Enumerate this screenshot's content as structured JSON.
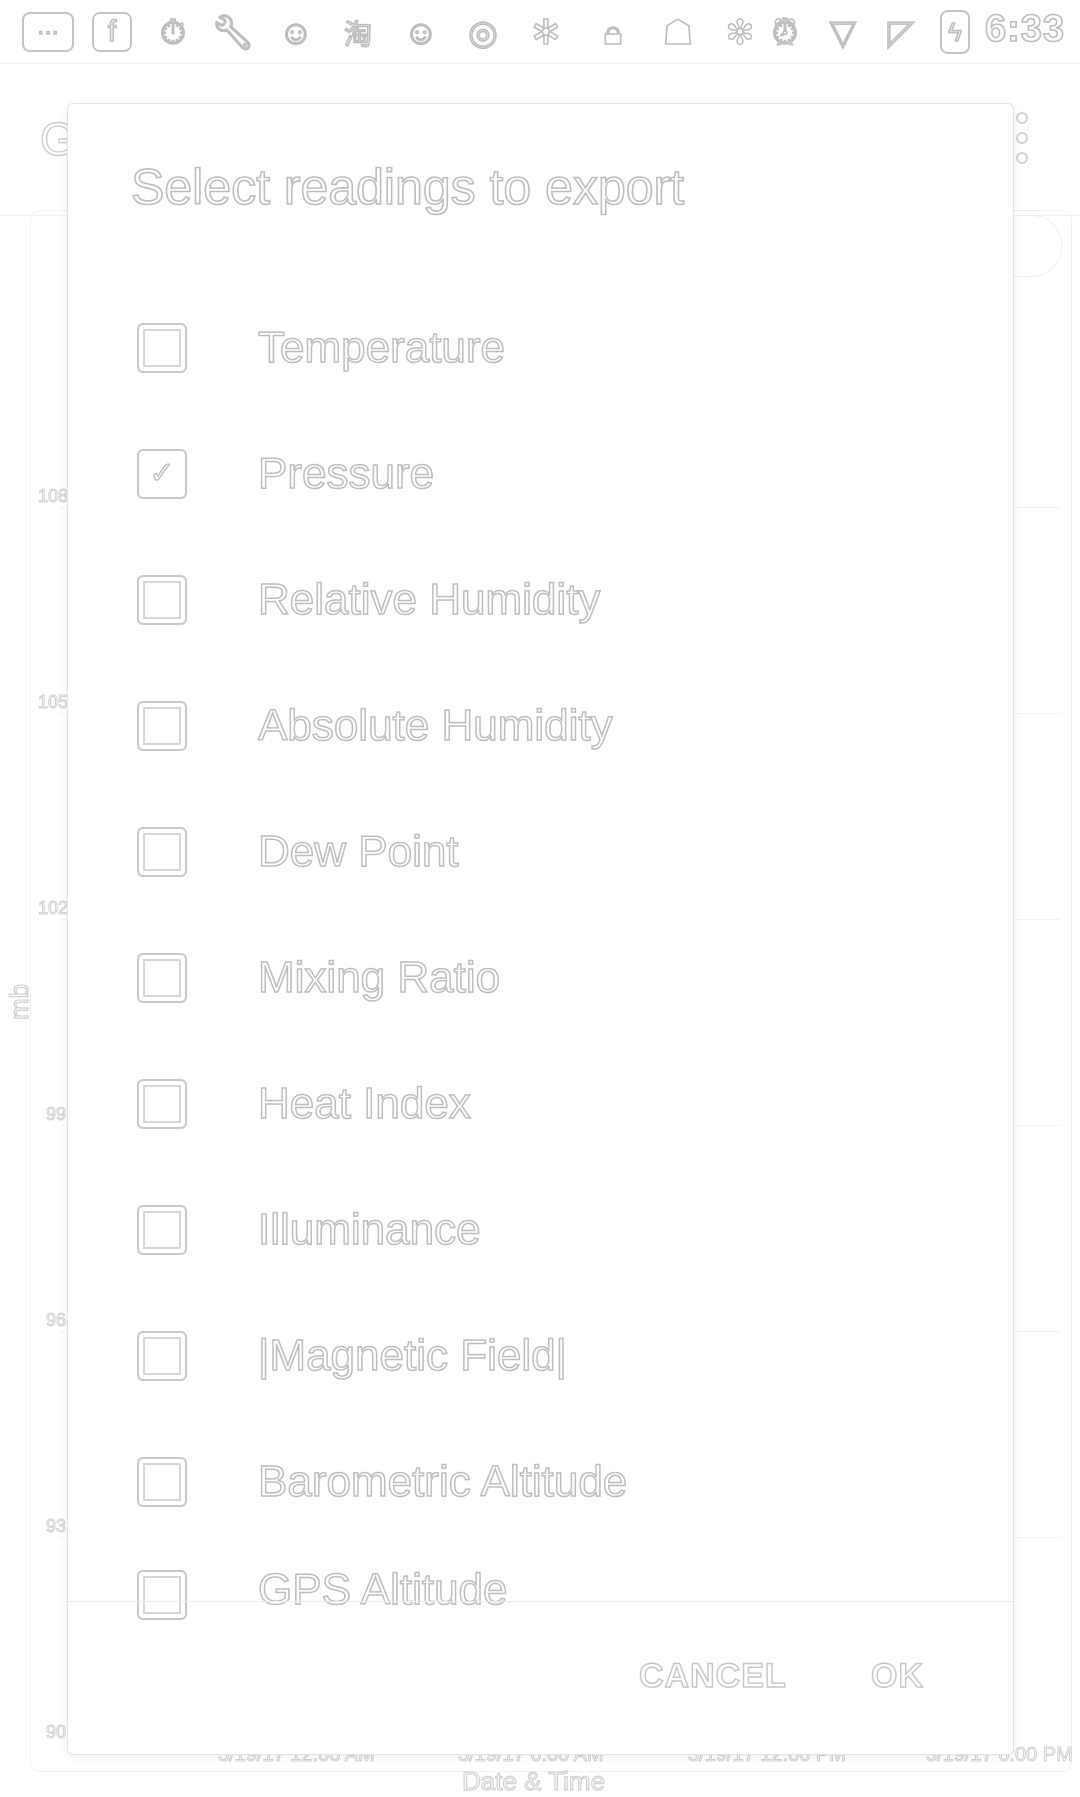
{
  "status_bar": {
    "time": "6:33",
    "icons": [
      "more-bubble-icon",
      "facebook-icon",
      "stopwatch-icon",
      "wrench-icon",
      "smiley-icon",
      "taobao-icon",
      "smiley-icon",
      "circle-app-icon",
      "puzzle-icon",
      "lock-icon",
      "android-icon",
      "bluetooth-icon",
      "alarm-icon",
      "wifi-icon",
      "no-sim-icon",
      "battery-charging-icon"
    ]
  },
  "background_chart": {
    "y_axis_label": "mb",
    "y_ticks": [
      "108",
      "105",
      "102",
      "99",
      "96",
      "93",
      "90"
    ],
    "x_ticks": [
      "3/19/17 12:00 AM",
      "3/19/17 6:00 AM",
      "3/19/17 12:00 PM",
      "3/19/17 6:00 PM"
    ],
    "x_axis_label": "Date & Time",
    "title_fragment": "G"
  },
  "dialog": {
    "title": "Select readings to export",
    "options": [
      {
        "label": "Temperature",
        "checked": false
      },
      {
        "label": "Pressure",
        "checked": true
      },
      {
        "label": "Relative Humidity",
        "checked": false
      },
      {
        "label": "Absolute Humidity",
        "checked": false
      },
      {
        "label": "Dew Point",
        "checked": false
      },
      {
        "label": "Mixing Ratio",
        "checked": false
      },
      {
        "label": "Heat Index",
        "checked": false
      },
      {
        "label": "Illuminance",
        "checked": false
      },
      {
        "label": "|Magnetic Field|",
        "checked": false
      },
      {
        "label": "Barometric Altitude",
        "checked": false
      },
      {
        "label": "GPS Altitude",
        "checked": false
      }
    ],
    "cancel_label": "CANCEL",
    "ok_label": "OK"
  }
}
